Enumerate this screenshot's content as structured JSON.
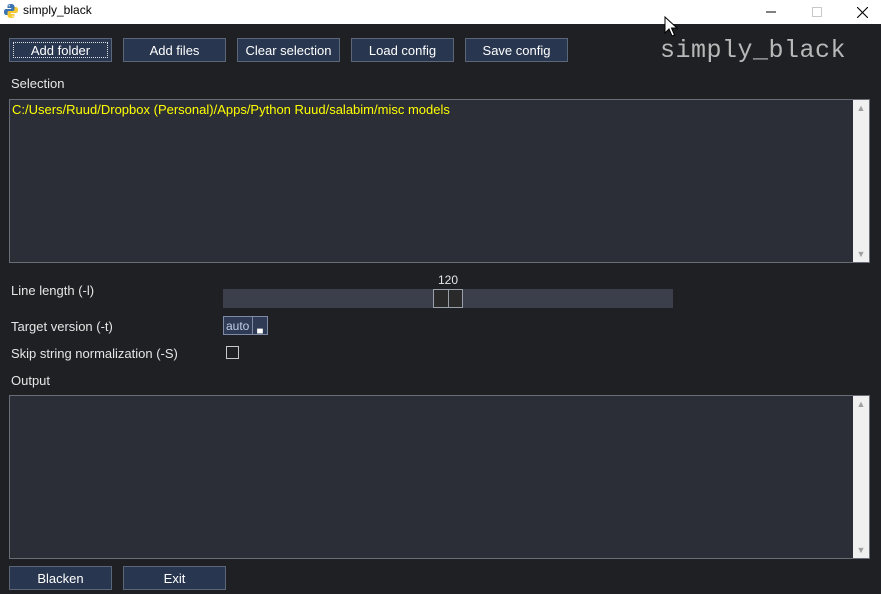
{
  "window": {
    "title": "simply_black",
    "minimize_glyph": "—",
    "maximize_glyph": "☐",
    "close_glyph": "✕",
    "icon": "python-icon"
  },
  "toolbar": {
    "add_folder": "Add folder",
    "add_files": "Add files",
    "clear_selection": "Clear selection",
    "load_config": "Load config",
    "save_config": "Save config"
  },
  "brand": "simply_black",
  "selection": {
    "label": "Selection",
    "items": [
      "C:/Users/Ruud/Dropbox (Personal)/Apps/Python Ruud/salabim/misc models"
    ]
  },
  "options": {
    "line_length_label": "Line length (-l)",
    "line_length_value": "120",
    "line_length_fraction": 0.5,
    "target_version_label": "Target version (-t)",
    "target_version_value": "auto",
    "skip_string_label": "Skip string normalization (-S)",
    "skip_string_checked": false
  },
  "output": {
    "label": "Output",
    "text": ""
  },
  "footer": {
    "blacken": "Blacken",
    "exit": "Exit"
  },
  "colors": {
    "background": "#1f2024",
    "button": "#283650",
    "selection_text": "#ffff00"
  }
}
